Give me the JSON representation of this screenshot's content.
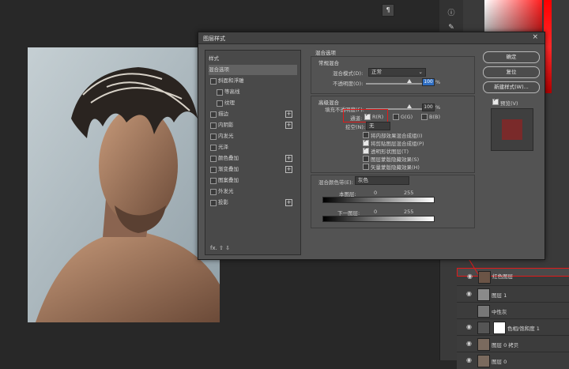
{
  "canvas": {
    "background": "#282828"
  },
  "widget": {
    "icon": "paragraph-icon",
    "glyph": "¶"
  },
  "tools": [
    "ⓘ",
    "✎",
    "▭",
    "≡"
  ],
  "layers": [
    {
      "name": "红色图层",
      "selected": true
    },
    {
      "name": "图层 1",
      "selected": false
    },
    {
      "name": "中性灰",
      "selected": false
    },
    {
      "name": "色相/饱和度 1",
      "selected": false
    },
    {
      "name": "图层 0 拷贝",
      "selected": false
    },
    {
      "name": "图层 0",
      "selected": false
    }
  ],
  "dialog": {
    "title": "图层样式",
    "close": "×",
    "styles_header": "样式",
    "styles": [
      {
        "label": "混合选项",
        "checkbox": false,
        "plus": false,
        "highlight": true
      },
      {
        "label": "斜面和浮雕",
        "checkbox": true,
        "plus": false
      },
      {
        "label": "等高线",
        "checkbox": true,
        "plus": false,
        "indent": true
      },
      {
        "label": "纹理",
        "checkbox": true,
        "plus": false,
        "indent": true
      },
      {
        "label": "描边",
        "checkbox": true,
        "plus": true
      },
      {
        "label": "内阴影",
        "checkbox": true,
        "plus": true
      },
      {
        "label": "内发光",
        "checkbox": true,
        "plus": false
      },
      {
        "label": "光泽",
        "checkbox": true,
        "plus": false
      },
      {
        "label": "颜色叠加",
        "checkbox": true,
        "plus": true
      },
      {
        "label": "渐变叠加",
        "checkbox": true,
        "plus": true
      },
      {
        "label": "图案叠加",
        "checkbox": true,
        "plus": false
      },
      {
        "label": "外发光",
        "checkbox": true,
        "plus": false
      },
      {
        "label": "投影",
        "checkbox": true,
        "plus": true
      }
    ],
    "footer": "fx.  ⇧  ⇩",
    "blend_options_title": "混合选项",
    "general_title": "常规混合",
    "blend_mode_label": "混合模式(D):",
    "blend_mode_value": "正常",
    "opacity_label": "不透明度(O):",
    "opacity_value": "100",
    "opacity_unit": "%",
    "advanced_title": "高级混合",
    "fill_opacity_label": "填充不透明度(F):",
    "fill_opacity_value": "100",
    "fill_unit": "%",
    "channels_label": "通道:",
    "channel_r": "R(R)",
    "channel_g": "G(G)",
    "channel_b": "B(B)",
    "knockout_label": "挖空(N):",
    "knockout_value": "无",
    "options": [
      {
        "label": "将内部效果混合成组(I)",
        "checked": false
      },
      {
        "label": "将剪贴图层混合成组(P)",
        "checked": true
      },
      {
        "label": "透明形状图层(T)",
        "checked": true
      },
      {
        "label": "图层蒙版隐藏效果(S)",
        "checked": false
      },
      {
        "label": "矢量蒙版隐藏效果(H)",
        "checked": false
      }
    ],
    "blend_if_label": "混合颜色带(E):",
    "blend_if_value": "灰色",
    "this_layer_label": "本图层:",
    "this_layer_min": "0",
    "this_layer_max": "255",
    "under_layer_label": "下一图层:",
    "under_layer_min": "0",
    "under_layer_max": "255",
    "buttons": {
      "ok": "确定",
      "reset": "复位",
      "new_style": "新建样式(W)...",
      "preview_label": "预览(V)"
    },
    "preview_color": "#7a2a2a"
  },
  "accent_red": "#e01a1a"
}
